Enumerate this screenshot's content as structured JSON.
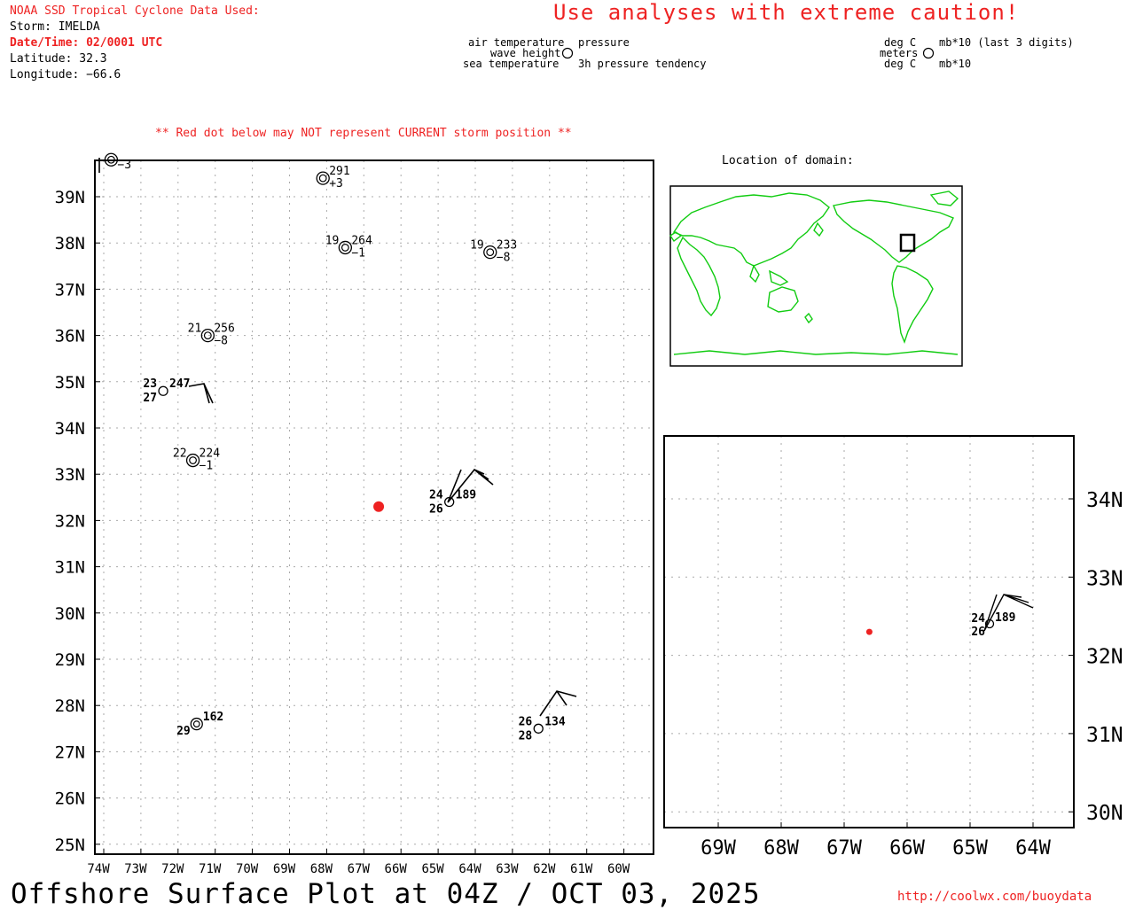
{
  "header": {
    "source_line": "NOAA SSD Tropical Cyclone Data Used:",
    "storm": "Storm: IMELDA",
    "datetime": "Date/Time: 02/0001 UTC",
    "latitude": "Latitude: 32.3",
    "longitude": "Longitude: −66.6",
    "caution": "Use analyses with extreme caution!",
    "red_dot_note": "** Red dot below may NOT represent CURRENT storm position **"
  },
  "legend": {
    "air_temperature": "air temperature",
    "wave_height": "wave height",
    "sea_temperature": "sea temperature",
    "pressure": "pressure",
    "pressure_tendency": "3h pressure tendency",
    "unit_deg_c_top": "deg C",
    "unit_meters": "meters",
    "unit_deg_c_bottom": "deg C",
    "unit_mb_top": "mb*10 (last 3 digits)",
    "unit_mb_bottom": "mb*10"
  },
  "inset": {
    "title": "Location of domain:"
  },
  "main_map": {
    "lat_labels": [
      "39N",
      "38N",
      "37N",
      "36N",
      "35N",
      "34N",
      "33N",
      "32N",
      "31N",
      "30N",
      "29N",
      "28N",
      "27N",
      "26N",
      "25N"
    ],
    "lon_labels": [
      "74W",
      "73W",
      "72W",
      "71W",
      "70W",
      "69W",
      "68W",
      "67W",
      "66W",
      "65W",
      "64W",
      "63W",
      "62W",
      "61W",
      "60W"
    ],
    "storm_position": {
      "lat": 32.3,
      "lon": -66.6
    },
    "stations": [
      {
        "id": "st-topleft",
        "lat": 39.8,
        "lon": -73.8,
        "tendency": "−3"
      },
      {
        "id": "st-a",
        "lat": 39.4,
        "lon": -68.1,
        "pressure": "291",
        "tendency": "+3"
      },
      {
        "id": "st-b",
        "lat": 37.9,
        "lon": -67.5,
        "airtemp": "19",
        "pressure": "264",
        "tendency": "−1"
      },
      {
        "id": "st-c",
        "lat": 37.8,
        "lon": -63.6,
        "airtemp": "19",
        "pressure": "233",
        "tendency": "−8"
      },
      {
        "id": "st-d",
        "lat": 36.0,
        "lon": -71.2,
        "airtemp": "21",
        "pressure": "256",
        "tendency": "−8"
      },
      {
        "id": "st-e",
        "lat": 34.8,
        "lon": -72.4,
        "airtemp": "23",
        "pressure": "247",
        "seatemp": "27"
      },
      {
        "id": "st-f",
        "lat": 33.3,
        "lon": -71.6,
        "airtemp": "22",
        "pressure": "224",
        "tendency": "−1"
      },
      {
        "id": "st-g",
        "lat": 32.4,
        "lon": -64.7,
        "airtemp": "24",
        "pressure": "189",
        "seatemp": "26"
      },
      {
        "id": "st-h",
        "lat": 27.6,
        "lon": -71.5,
        "pressure": "162",
        "seatemp": "29"
      },
      {
        "id": "st-i",
        "lat": 27.5,
        "lon": -62.3,
        "airtemp": "26",
        "pressure": "134",
        "seatemp": "28"
      }
    ]
  },
  "zoom_map": {
    "lat_labels": [
      "34N",
      "33N",
      "32N",
      "31N",
      "30N"
    ],
    "lon_labels": [
      "69W",
      "68W",
      "67W",
      "66W",
      "65W",
      "64W"
    ],
    "station": {
      "airtemp": "24",
      "pressure": "189",
      "seatemp": "26"
    }
  },
  "footer": {
    "title": "Offshore Surface Plot at 04Z / OCT 03, 2025",
    "url": "http://coolwx.com/buoydata"
  },
  "colors": {
    "accent_red": "#ee2222",
    "coast_green": "#11cc11",
    "grid": "#aaaaaa"
  }
}
